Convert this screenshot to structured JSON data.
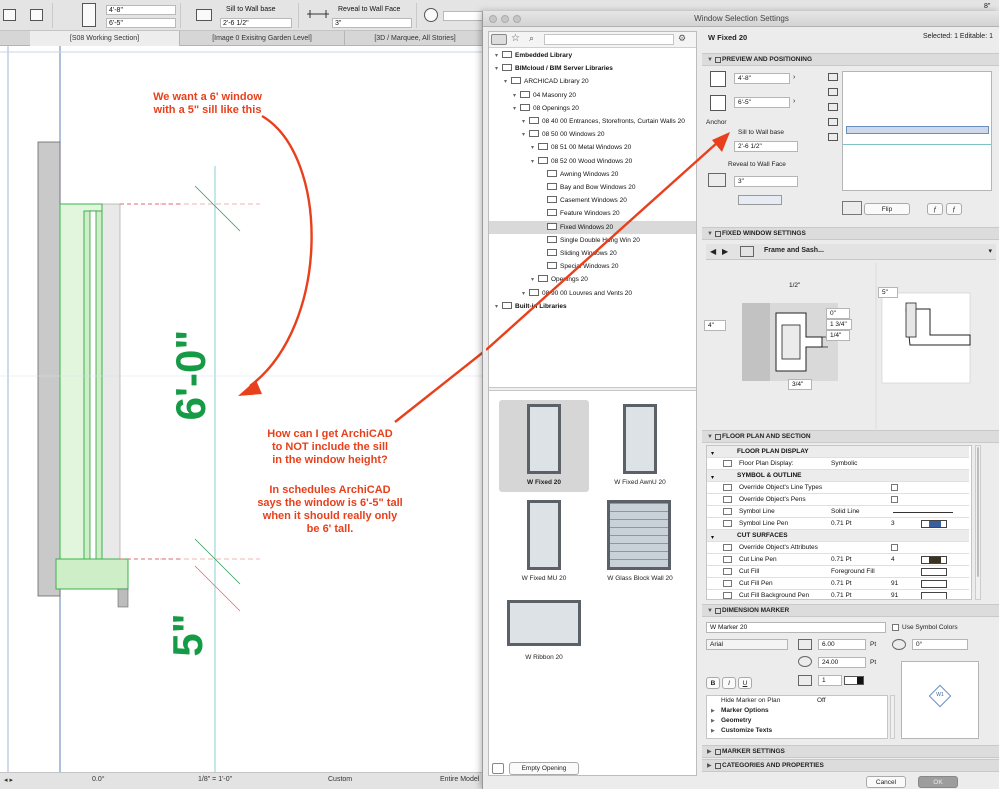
{
  "infobox": {
    "height_value": "4'-8\"",
    "width_value": "6'-5\"",
    "sill_label": "Sill to Wall base",
    "sill_value": "2'-6 1/2\"",
    "reveal_label": "Reveal to Wall Face",
    "reveal_value": "3\"",
    "right_value": "8\""
  },
  "tabs": [
    {
      "label": "[S08 Working Section]"
    },
    {
      "label": "[Image 0 Exisitng Garden Level]"
    },
    {
      "label": "[3D / Marquee, All Stories]"
    }
  ],
  "drawing": {
    "callout_top_line1": "We want a 6' window",
    "callout_top_line2": "with a 5\" sill like this",
    "callout_q_line1": "How can I get ArchiCAD",
    "callout_q_line2": "to NOT include the sill",
    "callout_q_line3": "in the window height?",
    "callout_s_line1": "In schedules ArchiCAD",
    "callout_s_line2": "says the window is 6'-5\" tall",
    "callout_s_line3": "when it should really only",
    "callout_s_line4": "be 6' tall.",
    "dim_big": "6'-0\"",
    "dim_small": "5\""
  },
  "status": {
    "angle": "0.0°",
    "scale": "1/8\"  =  1'-0\"",
    "custom": "Custom",
    "entire": "Entire Model"
  },
  "dialog": {
    "title": "Window Selection Settings",
    "object_name": "W Fixed 20",
    "selected_info": "Selected: 1 Editable: 1"
  },
  "library": {
    "tree": [
      {
        "label": "Embedded Library",
        "indent": 0,
        "bold": true
      },
      {
        "label": "BIMcloud / BIM Server Libraries",
        "indent": 0,
        "bold": true
      },
      {
        "label": "ARCHICAD Library 20",
        "indent": 1
      },
      {
        "label": "04 Masonry 20",
        "indent": 2
      },
      {
        "label": "08 Openings 20",
        "indent": 2
      },
      {
        "label": "08 40 00 Entrances, Storefronts, Curtain Walls 20",
        "indent": 3
      },
      {
        "label": "08 50 00 Windows 20",
        "indent": 3
      },
      {
        "label": "08 51 00 Metal Windows 20",
        "indent": 4
      },
      {
        "label": "08 52 00 Wood Windows 20",
        "indent": 4
      },
      {
        "label": "Awning Windows 20",
        "indent": 5
      },
      {
        "label": "Bay and Bow Windows 20",
        "indent": 5
      },
      {
        "label": "Casement Windows 20",
        "indent": 5
      },
      {
        "label": "Feature Windows 20",
        "indent": 5
      },
      {
        "label": "Fixed Windows 20",
        "indent": 5,
        "selected": true
      },
      {
        "label": "Single Double Hung Win 20",
        "indent": 5
      },
      {
        "label": "Sliding Windows 20",
        "indent": 5
      },
      {
        "label": "Special Windows 20",
        "indent": 5
      },
      {
        "label": "Openings 20",
        "indent": 4
      },
      {
        "label": "08 90 00 Louvres and Vents 20",
        "indent": 3
      },
      {
        "label": "Built-in Libraries",
        "indent": 0,
        "bold": true
      }
    ],
    "thumbs": [
      {
        "label": "W Fixed 20"
      },
      {
        "label": "W Fixed AwnU 20"
      },
      {
        "label": "W Fixed MU 20"
      },
      {
        "label": "W Glass Block Wall 20"
      },
      {
        "label": "W Ribbon 20"
      }
    ],
    "empty_opening": "Empty Opening"
  },
  "preview": {
    "header": "PREVIEW AND POSITIONING",
    "height_value": "4'-8\"",
    "width_value": "6'-5\"",
    "anchor_label": "Anchor",
    "sill_label": "Sill to Wall base",
    "sill_value": "2'-6 1/2\"",
    "reveal_label": "Reveal to Wall Face",
    "reveal_value": "3\"",
    "flip_label": "Flip"
  },
  "fixed": {
    "header": "FIXED WINDOW SETTINGS",
    "page_label": "Frame and Sash...",
    "dims": [
      "1/2\"",
      "0\"",
      "1 3/4\"",
      "1/4\"",
      "3/4\"",
      "4\"",
      "5\""
    ]
  },
  "floorplan": {
    "header": "FLOOR PLAN AND SECTION",
    "rows": [
      {
        "name": "FLOOR PLAN DISPLAY",
        "value": "",
        "group": true
      },
      {
        "name": "Floor Plan Display:",
        "value": "Symbolic"
      },
      {
        "name": "SYMBOL & OUTLINE",
        "value": "",
        "group": true
      },
      {
        "name": "Override Object's Line Types",
        "value": ""
      },
      {
        "name": "Override Object's Pens",
        "value": ""
      },
      {
        "name": "Symbol Line",
        "value": "Solid Line"
      },
      {
        "name": "Symbol Line Pen",
        "value": "0.71 Pt",
        "extra": "3"
      },
      {
        "name": "CUT SURFACES",
        "value": "",
        "group": true
      },
      {
        "name": "Override Object's Attributes",
        "value": ""
      },
      {
        "name": "Cut Line Pen",
        "value": "0.71 Pt",
        "extra": "4"
      },
      {
        "name": "Cut Fill",
        "value": "Foreground Fill"
      },
      {
        "name": "Cut Fill Pen",
        "value": "0.71 Pt",
        "extra": "91"
      },
      {
        "name": "Cut Fill Background Pen",
        "value": "0.71 Pt",
        "extra": "91"
      }
    ]
  },
  "dimmarker": {
    "header": "DIMENSION MARKER",
    "marker": "W Marker 20",
    "use_symbol_colors": "Use Symbol Colors",
    "font": "Arial",
    "font_size": "6.00",
    "font_unit": "Pt",
    "size2": "24.00",
    "size2_unit": "Pt",
    "pen": "1",
    "angle": "0°",
    "bold_label": "B",
    "italic_label": "I",
    "underline_label": "U",
    "tree": [
      {
        "name": "Hide Marker on Plan",
        "value": "Off"
      },
      {
        "name": "Marker Options",
        "value": ""
      },
      {
        "name": "Geometry",
        "value": ""
      },
      {
        "name": "Customize Texts",
        "value": ""
      }
    ],
    "marker_preview": "W1"
  },
  "sections": {
    "marker_settings": "MARKER SETTINGS",
    "categories": "CATEGORIES AND PROPERTIES"
  },
  "buttons": {
    "cancel": "Cancel",
    "ok": "OK"
  }
}
